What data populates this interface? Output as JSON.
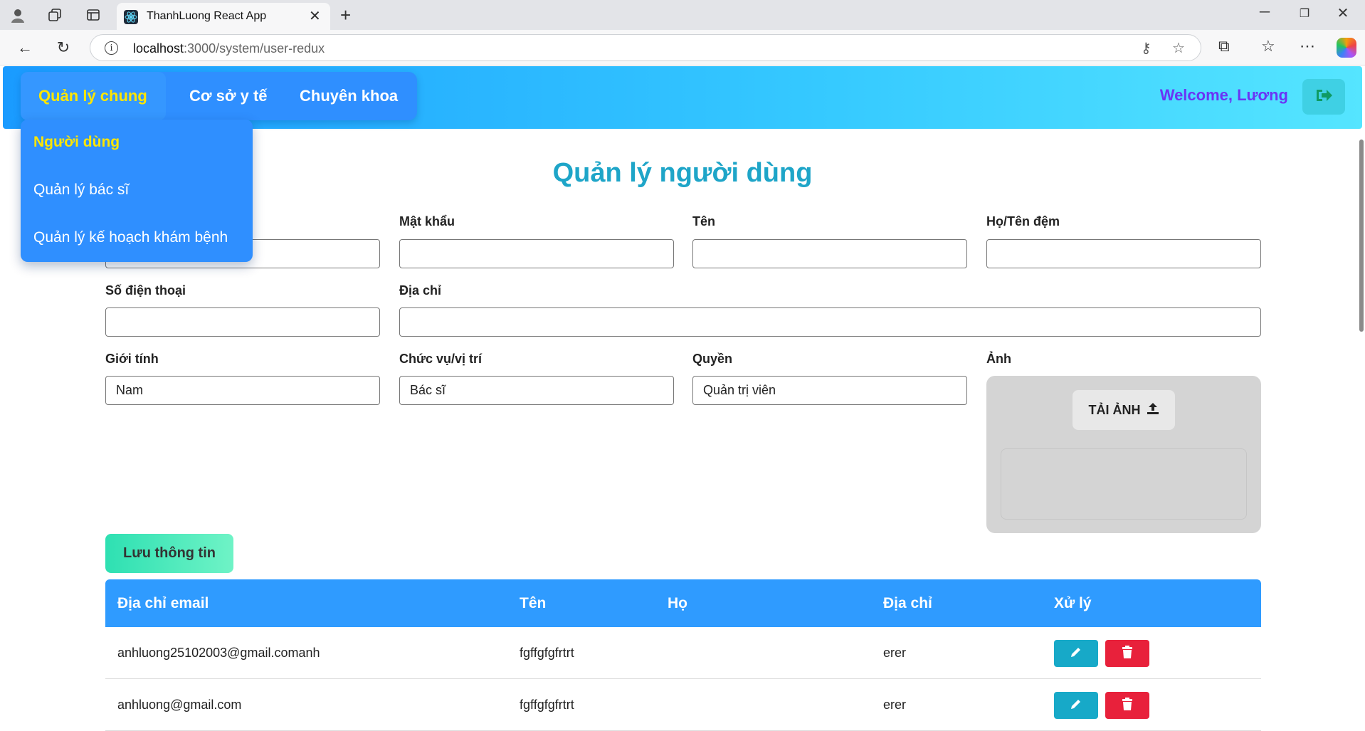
{
  "browser": {
    "tab_title": "ThanhLuong React App",
    "url_host": "localhost",
    "url_rest": ":3000/system/user-redux"
  },
  "header": {
    "menu": [
      "Quản lý chung",
      "Cơ sở y tế",
      "Chuyên khoa"
    ],
    "welcome": "Welcome, Lương",
    "dropdown": [
      "Người dùng",
      "Quản lý bác sĩ",
      "Quản lý kế hoạch khám bệnh"
    ]
  },
  "page": {
    "title": "Quản lý người dùng"
  },
  "form": {
    "password_label": "Mật khẩu",
    "first_name_label": "Tên",
    "last_name_label": "Họ/Tên đệm",
    "phone_label": "Số điện thoại",
    "address_label": "Địa chỉ",
    "gender_label": "Giới tính",
    "gender_value": "Nam",
    "position_label": "Chức vụ/vị trí",
    "position_value": "Bác sĩ",
    "role_label": "Quyền",
    "role_value": "Quản trị viên",
    "image_label": "Ảnh",
    "upload_label": "TẢI ẢNH",
    "save_label": "Lưu thông tin"
  },
  "table": {
    "headers": [
      "Địa chỉ email",
      "Tên",
      "Họ",
      "Địa chỉ",
      "Xử lý"
    ],
    "rows": [
      {
        "email": "anhluong25102003@gmail.comanh",
        "first_name": "fgffgfgfrtrt",
        "last_name": "",
        "address": "erer"
      },
      {
        "email": "anhluong@gmail.com",
        "first_name": "fgffgfgfrtrt",
        "last_name": "",
        "address": "erer"
      }
    ]
  },
  "colors": {
    "header_gradient_start": "#1a9bff",
    "header_gradient_end": "#55e5ff",
    "active_menu_text": "#ffe600",
    "title": "#1ea5c8",
    "table_header": "#2f9bff",
    "edit_button": "#17a9c8",
    "delete_button": "#e8213b"
  }
}
